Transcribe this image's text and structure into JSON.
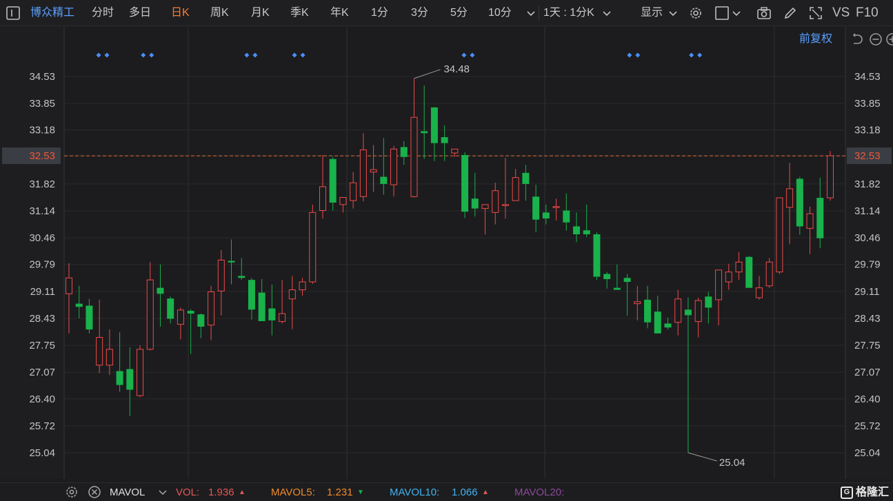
{
  "app": {
    "stock_name": "博众精工",
    "period_tabs": [
      {
        "label": "分时",
        "active": false
      },
      {
        "label": "多日",
        "active": false
      },
      {
        "label": "日K",
        "active": true
      },
      {
        "label": "周K",
        "active": false
      },
      {
        "label": "月K",
        "active": false
      },
      {
        "label": "季K",
        "active": false
      },
      {
        "label": "年K",
        "active": false
      },
      {
        "label": "1分",
        "active": false
      },
      {
        "label": "3分",
        "active": false
      },
      {
        "label": "5分",
        "active": false
      },
      {
        "label": "10分",
        "active": false
      }
    ],
    "multi_period": "1天 : 1分K",
    "display_label": "显示",
    "vs_label": "VS",
    "f10_label": "F10",
    "adjust_label": "前复权"
  },
  "chart_data": {
    "type": "candlestick",
    "y_ticks": [
      "34.53",
      "33.85",
      "33.18",
      "32.53",
      "31.82",
      "31.14",
      "30.46",
      "29.79",
      "29.11",
      "28.43",
      "27.75",
      "27.07",
      "26.40",
      "25.72",
      "25.04"
    ],
    "ylim": [
      24.55,
      35.03
    ],
    "current_price": 32.53,
    "max_label": "34.48",
    "min_label": "25.04",
    "colors": {
      "up": "#ef4a4a",
      "down": "#19b24b",
      "dashed": "#e06a3a",
      "marker": "#4a8fff"
    },
    "candles": [
      {
        "o": 29.05,
        "h": 29.82,
        "l": 28.05,
        "c": 29.45
      },
      {
        "o": 28.8,
        "h": 29.25,
        "l": 28.43,
        "c": 28.72
      },
      {
        "o": 28.75,
        "h": 28.92,
        "l": 28.05,
        "c": 28.15
      },
      {
        "o": 27.25,
        "h": 28.9,
        "l": 27.05,
        "c": 27.95
      },
      {
        "o": 27.25,
        "h": 28.15,
        "l": 27.0,
        "c": 27.65
      },
      {
        "o": 27.1,
        "h": 28.08,
        "l": 26.58,
        "c": 26.75
      },
      {
        "o": 27.15,
        "h": 27.7,
        "l": 25.97,
        "c": 26.63
      },
      {
        "o": 26.48,
        "h": 27.75,
        "l": 26.44,
        "c": 27.65
      },
      {
        "o": 27.65,
        "h": 29.85,
        "l": 27.62,
        "c": 29.4
      },
      {
        "o": 29.2,
        "h": 29.79,
        "l": 28.22,
        "c": 29.05
      },
      {
        "o": 28.93,
        "h": 28.98,
        "l": 28.3,
        "c": 28.42
      },
      {
        "o": 28.28,
        "h": 28.7,
        "l": 27.9,
        "c": 28.64
      },
      {
        "o": 28.62,
        "h": 28.66,
        "l": 27.53,
        "c": 28.55
      },
      {
        "o": 28.53,
        "h": 28.55,
        "l": 27.93,
        "c": 28.22
      },
      {
        "o": 28.26,
        "h": 29.25,
        "l": 27.88,
        "c": 29.1
      },
      {
        "o": 29.12,
        "h": 30.15,
        "l": 28.5,
        "c": 29.9
      },
      {
        "o": 29.88,
        "h": 30.42,
        "l": 29.29,
        "c": 29.84
      },
      {
        "o": 29.5,
        "h": 29.95,
        "l": 29.4,
        "c": 29.45
      },
      {
        "o": 29.4,
        "h": 29.45,
        "l": 28.4,
        "c": 28.65
      },
      {
        "o": 29.08,
        "h": 29.42,
        "l": 28.41,
        "c": 28.36
      },
      {
        "o": 28.68,
        "h": 29.28,
        "l": 28.0,
        "c": 28.38
      },
      {
        "o": 28.35,
        "h": 29.4,
        "l": 28.3,
        "c": 28.55
      },
      {
        "o": 28.92,
        "h": 29.5,
        "l": 28.16,
        "c": 29.15
      },
      {
        "o": 29.15,
        "h": 29.45,
        "l": 29.0,
        "c": 29.35
      },
      {
        "o": 29.35,
        "h": 31.3,
        "l": 29.3,
        "c": 31.1
      },
      {
        "o": 31.15,
        "h": 32.55,
        "l": 30.95,
        "c": 31.75
      },
      {
        "o": 32.45,
        "h": 32.5,
        "l": 31.15,
        "c": 31.35
      },
      {
        "o": 31.3,
        "h": 31.48,
        "l": 31.1,
        "c": 31.48
      },
      {
        "o": 31.4,
        "h": 32.12,
        "l": 31.2,
        "c": 31.85
      },
      {
        "o": 31.5,
        "h": 33.1,
        "l": 31.38,
        "c": 32.68
      },
      {
        "o": 32.12,
        "h": 32.8,
        "l": 31.62,
        "c": 32.18
      },
      {
        "o": 32.0,
        "h": 32.98,
        "l": 31.55,
        "c": 31.82
      },
      {
        "o": 31.8,
        "h": 32.78,
        "l": 31.51,
        "c": 32.7
      },
      {
        "o": 32.75,
        "h": 32.9,
        "l": 32.3,
        "c": 32.5
      },
      {
        "o": 31.5,
        "h": 34.48,
        "l": 31.48,
        "c": 33.5
      },
      {
        "o": 33.15,
        "h": 34.3,
        "l": 32.45,
        "c": 33.1
      },
      {
        "o": 33.75,
        "h": 33.76,
        "l": 32.4,
        "c": 32.85
      },
      {
        "o": 33.0,
        "h": 33.3,
        "l": 32.4,
        "c": 32.85
      },
      {
        "o": 32.6,
        "h": 32.7,
        "l": 32.5,
        "c": 32.7
      },
      {
        "o": 32.55,
        "h": 32.62,
        "l": 30.96,
        "c": 31.12
      },
      {
        "o": 31.45,
        "h": 32.1,
        "l": 31.0,
        "c": 31.2
      },
      {
        "o": 31.2,
        "h": 31.3,
        "l": 30.55,
        "c": 31.3
      },
      {
        "o": 31.1,
        "h": 31.85,
        "l": 30.8,
        "c": 31.65
      },
      {
        "o": 31.3,
        "h": 32.48,
        "l": 30.95,
        "c": 31.3
      },
      {
        "o": 31.4,
        "h": 32.2,
        "l": 31.4,
        "c": 31.98
      },
      {
        "o": 32.1,
        "h": 32.3,
        "l": 31.4,
        "c": 31.82
      },
      {
        "o": 31.5,
        "h": 31.8,
        "l": 30.6,
        "c": 30.92
      },
      {
        "o": 31.1,
        "h": 31.3,
        "l": 30.8,
        "c": 30.95
      },
      {
        "o": 31.23,
        "h": 31.45,
        "l": 30.9,
        "c": 31.25
      },
      {
        "o": 31.15,
        "h": 31.58,
        "l": 30.64,
        "c": 30.85
      },
      {
        "o": 30.75,
        "h": 31.1,
        "l": 30.35,
        "c": 30.55
      },
      {
        "o": 30.65,
        "h": 31.3,
        "l": 30.48,
        "c": 30.55
      },
      {
        "o": 30.55,
        "h": 30.6,
        "l": 29.4,
        "c": 29.48
      },
      {
        "o": 29.55,
        "h": 29.6,
        "l": 29.18,
        "c": 29.42
      },
      {
        "o": 29.2,
        "h": 29.79,
        "l": 29.15,
        "c": 29.15
      },
      {
        "o": 29.45,
        "h": 29.55,
        "l": 28.5,
        "c": 29.35
      },
      {
        "o": 28.8,
        "h": 29.25,
        "l": 28.38,
        "c": 28.85
      },
      {
        "o": 28.9,
        "h": 29.25,
        "l": 28.18,
        "c": 28.33
      },
      {
        "o": 28.6,
        "h": 29.0,
        "l": 28.05,
        "c": 28.05
      },
      {
        "o": 28.3,
        "h": 28.45,
        "l": 28.15,
        "c": 28.2
      },
      {
        "o": 28.33,
        "h": 29.15,
        "l": 28.0,
        "c": 28.92
      },
      {
        "o": 28.65,
        "h": 28.96,
        "l": 25.04,
        "c": 28.51
      },
      {
        "o": 28.35,
        "h": 28.95,
        "l": 27.95,
        "c": 28.88
      },
      {
        "o": 28.98,
        "h": 29.1,
        "l": 28.3,
        "c": 28.7
      },
      {
        "o": 28.9,
        "h": 29.65,
        "l": 28.25,
        "c": 29.65
      },
      {
        "o": 29.35,
        "h": 29.8,
        "l": 29.15,
        "c": 29.6
      },
      {
        "o": 29.6,
        "h": 30.1,
        "l": 29.4,
        "c": 29.85
      },
      {
        "o": 29.98,
        "h": 30.0,
        "l": 29.2,
        "c": 29.2
      },
      {
        "o": 28.95,
        "h": 29.5,
        "l": 28.9,
        "c": 29.2
      },
      {
        "o": 29.25,
        "h": 29.95,
        "l": 29.2,
        "c": 29.85
      },
      {
        "o": 29.6,
        "h": 30.55,
        "l": 29.55,
        "c": 31.47
      },
      {
        "o": 31.23,
        "h": 32.35,
        "l": 30.3,
        "c": 31.7
      },
      {
        "o": 31.95,
        "h": 32.0,
        "l": 30.54,
        "c": 30.75
      },
      {
        "o": 30.7,
        "h": 31.25,
        "l": 30.05,
        "c": 31.07
      },
      {
        "o": 31.47,
        "h": 31.98,
        "l": 30.2,
        "c": 30.45
      },
      {
        "o": 31.47,
        "h": 32.65,
        "l": 31.4,
        "c": 32.53
      }
    ],
    "markers": [
      0.0,
      4.4,
      14.6,
      19.3,
      36.0,
      52.3,
      58.4
    ]
  },
  "bottom": {
    "indicator": "MAVOL",
    "vol_label": "VOL:",
    "vol_value": "1.936",
    "mavol5_label": "MAVOL5:",
    "mavol5_value": "1.231",
    "mavol10_label": "MAVOL10:",
    "mavol10_value": "1.066",
    "mavol20_label": "MAVOL20:",
    "logo_text": "格隆汇"
  }
}
